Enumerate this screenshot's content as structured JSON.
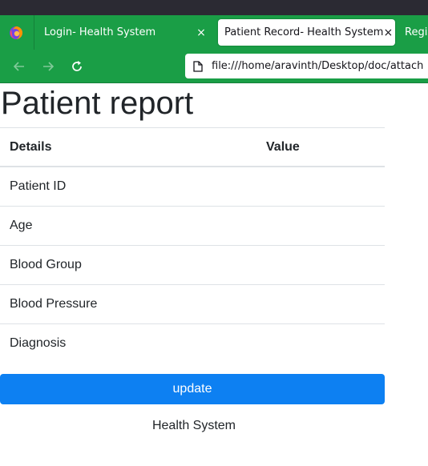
{
  "browser": {
    "tabs": [
      {
        "title": "Login- Health System",
        "active": false,
        "close_glyph": "×"
      },
      {
        "title": "Patient Record- Health System",
        "active": true,
        "close_glyph": "×"
      },
      {
        "title": "Regis",
        "active": false
      }
    ],
    "url": "file:///home/aravinth/Desktop/doc/attach",
    "accent_color": "#1a9e46",
    "icons": {
      "firefox": "firefox-icon",
      "back": "back-arrow-icon",
      "forward": "forward-arrow-icon",
      "reload": "reload-icon",
      "page": "document-icon"
    }
  },
  "page": {
    "title": "Patient report",
    "table": {
      "headers": [
        "Details",
        "Value"
      ],
      "rows": [
        {
          "label": "Patient ID",
          "value": ""
        },
        {
          "label": "Age",
          "value": ""
        },
        {
          "label": "Blood Group",
          "value": ""
        },
        {
          "label": "Blood Pressure",
          "value": ""
        },
        {
          "label": "Diagnosis",
          "value": ""
        }
      ]
    },
    "update_label": "update",
    "button_color": "#0d80f2",
    "footer": "Health System"
  }
}
